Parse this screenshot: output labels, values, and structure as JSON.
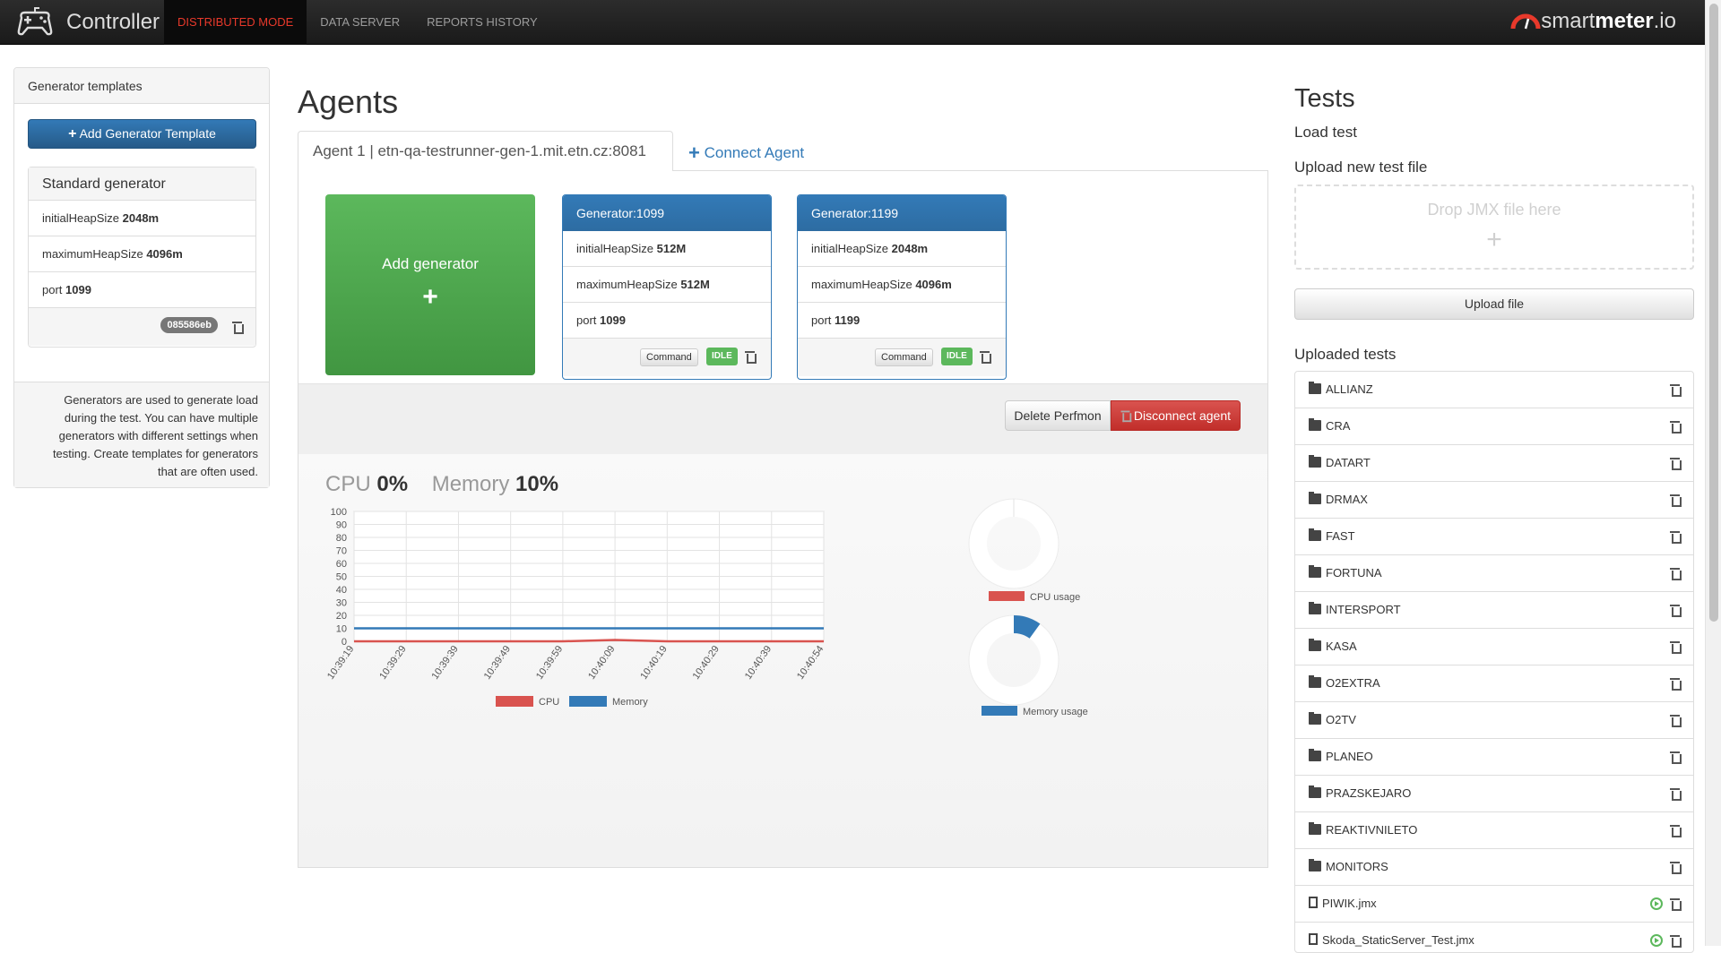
{
  "topbar": {
    "app_title": "Controller",
    "nav": [
      "DISTRIBUTED MODE",
      "DATA SERVER",
      "REPORTS HISTORY"
    ],
    "brand_light": "smart",
    "brand_bold": "meter",
    "brand_suffix": ".io"
  },
  "left": {
    "panel_title": "Generator templates",
    "add_template_label": "Add Generator Template",
    "template": {
      "name": "Standard generator",
      "rows": [
        {
          "key": "initialHeapSize",
          "value": "2048m"
        },
        {
          "key": "maximumHeapSize",
          "value": "4096m"
        },
        {
          "key": "port",
          "value": "1099"
        }
      ],
      "hash": "085586eb"
    },
    "help_text": "Generators are used to generate load during the test. You can have multiple generators with different settings when testing. Create templates for generators that are often used."
  },
  "center": {
    "title": "Agents",
    "active_tab": "Agent 1 | etn-qa-testrunner-gen-1.mit.etn.cz:8081",
    "connect_tab": "Connect Agent",
    "add_generator_label": "Add generator",
    "generators": [
      {
        "title": "Generator:1099",
        "rows": [
          {
            "key": "initialHeapSize",
            "value": "512M"
          },
          {
            "key": "maximumHeapSize",
            "value": "512M"
          },
          {
            "key": "port",
            "value": "1099"
          }
        ],
        "command_label": "Command",
        "status": "IDLE"
      },
      {
        "title": "Generator:1199",
        "rows": [
          {
            "key": "initialHeapSize",
            "value": "2048m"
          },
          {
            "key": "maximumHeapSize",
            "value": "4096m"
          },
          {
            "key": "port",
            "value": "1199"
          }
        ],
        "command_label": "Command",
        "status": "IDLE"
      }
    ],
    "delete_perfmon_label": "Delete Perfmon",
    "disconnect_label": "Disconnect agent",
    "cpu_label": "CPU",
    "cpu_value": "0%",
    "memory_label": "Memory",
    "memory_value": "10%"
  },
  "chart_data": [
    {
      "type": "line",
      "x": [
        "10:39:19",
        "10:39:29",
        "10:39:39",
        "10:39:49",
        "10:39:59",
        "10:40:09",
        "10:40:19",
        "10:40:29",
        "10:40:39",
        "10:40:54"
      ],
      "series": [
        {
          "name": "CPU",
          "color": "#d9534f",
          "values": [
            0,
            0,
            0,
            0,
            0,
            1,
            0,
            0,
            0,
            0
          ]
        },
        {
          "name": "Memory",
          "color": "#337ab7",
          "values": [
            10,
            10,
            10,
            10,
            10,
            10,
            10,
            10,
            10,
            10
          ]
        }
      ],
      "yticks": [
        0,
        10,
        20,
        30,
        40,
        50,
        60,
        70,
        80,
        90,
        100
      ],
      "ylim": [
        0,
        100
      ],
      "grid": true,
      "legend": "bottom"
    },
    {
      "type": "pie",
      "name": "CPU usage",
      "values": [
        0,
        100
      ],
      "color": "#d9534f",
      "legend": "bottom"
    },
    {
      "type": "pie",
      "name": "Memory usage",
      "values": [
        10,
        90
      ],
      "color": "#337ab7",
      "legend": "bottom"
    }
  ],
  "right": {
    "title": "Tests",
    "load_test_label": "Load test",
    "upload_new_label": "Upload new test file",
    "drop_placeholder": "Drop JMX file here",
    "upload_button": "Upload file",
    "uploaded_label": "Uploaded tests",
    "tests": [
      {
        "name": "ALLIANZ",
        "kind": "folder"
      },
      {
        "name": "CRA",
        "kind": "folder"
      },
      {
        "name": "DATART",
        "kind": "folder"
      },
      {
        "name": "DRMAX",
        "kind": "folder"
      },
      {
        "name": "FAST",
        "kind": "folder"
      },
      {
        "name": "FORTUNA",
        "kind": "folder"
      },
      {
        "name": "INTERSPORT",
        "kind": "folder"
      },
      {
        "name": "KASA",
        "kind": "folder"
      },
      {
        "name": "O2EXTRA",
        "kind": "folder"
      },
      {
        "name": "O2TV",
        "kind": "folder"
      },
      {
        "name": "PLANEO",
        "kind": "folder"
      },
      {
        "name": "PRAZSKEJARO",
        "kind": "folder"
      },
      {
        "name": "REAKTIVNILETO",
        "kind": "folder"
      },
      {
        "name": "MONITORS",
        "kind": "folder"
      },
      {
        "name": "PIWIK.jmx",
        "kind": "file"
      },
      {
        "name": "Skoda_StaticServer_Test.jmx",
        "kind": "file"
      }
    ]
  }
}
